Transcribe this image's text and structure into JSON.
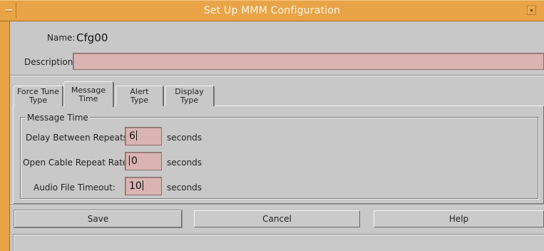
{
  "window": {
    "title": "Set Up MMM Configuration"
  },
  "form": {
    "name_label": "Name:",
    "name_value": "Cfg00",
    "description_label": "Description:",
    "description_value": ""
  },
  "tabs": [
    {
      "line1": "Force Tune",
      "line2": "Type"
    },
    {
      "line1": "Message",
      "line2": "Time"
    },
    {
      "line1": "Alert",
      "line2": "Type"
    },
    {
      "line1": "Display",
      "line2": "Type"
    }
  ],
  "active_tab": "Message Time",
  "message_time": {
    "group_title": "Message Time",
    "rows": [
      {
        "label": "Delay Between Repeats:",
        "value": "6",
        "unit": "seconds"
      },
      {
        "label": "Open Cable Repeat Rate:",
        "value": "0",
        "unit": "seconds"
      },
      {
        "label": "Audio File Timeout:",
        "value": "10",
        "unit": "seconds"
      }
    ]
  },
  "buttons": {
    "save": "Save",
    "cancel": "Cancel",
    "help": "Help"
  },
  "colors": {
    "titlebar": "#e8a447",
    "field": "#d9b4b2",
    "background": "#c8c8c8"
  },
  "icons": {
    "window_menu": "window-menu-icon",
    "minimize": "minimize-icon"
  }
}
